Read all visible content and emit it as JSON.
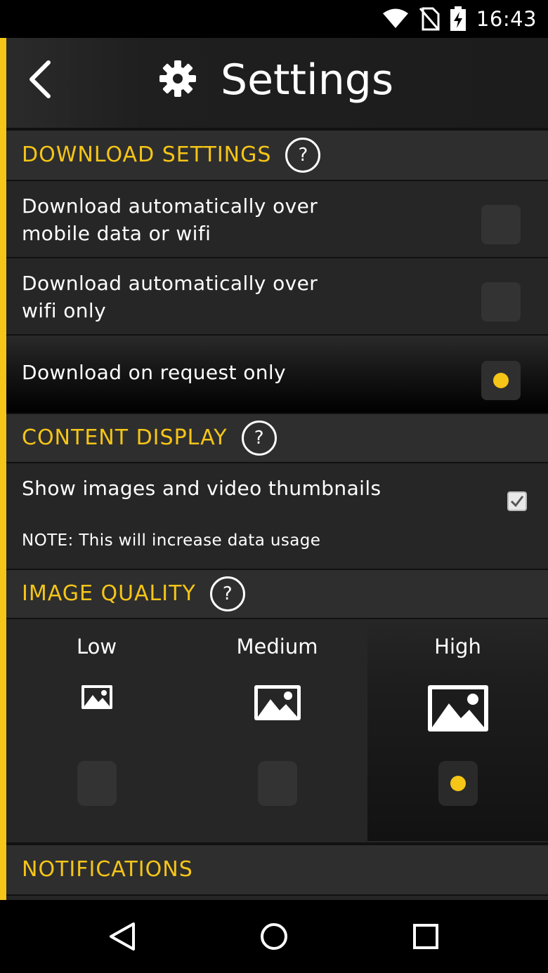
{
  "status_bar": {
    "time": "16:43",
    "icons": [
      "wifi-icon",
      "no-sim-icon",
      "battery-charging-icon"
    ]
  },
  "colors": {
    "accent": "#F5C518",
    "background": "#252525",
    "section_bg": "#2E2E2E"
  },
  "header": {
    "title": "Settings",
    "back_icon": "chevron-left-icon",
    "settings_icon": "gear-icon"
  },
  "sections": {
    "download": {
      "title": "DOWNLOAD SETTINGS",
      "help": "?",
      "options": [
        {
          "label_line1": "Download automatically over",
          "label_line2": "mobile data or wifi",
          "selected": false
        },
        {
          "label_line1": "Download automatically over",
          "label_line2": "wifi only",
          "selected": false
        },
        {
          "label_line1": "Download on request only",
          "label_line2": "",
          "selected": true
        }
      ]
    },
    "content_display": {
      "title": "CONTENT DISPLAY",
      "help": "?",
      "option_label": "Show images and video thumbnails",
      "note": "NOTE: This will increase data usage",
      "checked": true
    },
    "image_quality": {
      "title": "IMAGE QUALITY",
      "help": "?",
      "options": [
        {
          "label": "Low",
          "selected": false
        },
        {
          "label": "Medium",
          "selected": false
        },
        {
          "label": "High",
          "selected": true
        }
      ]
    },
    "notifications": {
      "title": "NOTIFICATIONS"
    }
  },
  "nav_bar": {
    "buttons": [
      "back-triangle-icon",
      "home-circle-icon",
      "recents-square-icon"
    ]
  }
}
